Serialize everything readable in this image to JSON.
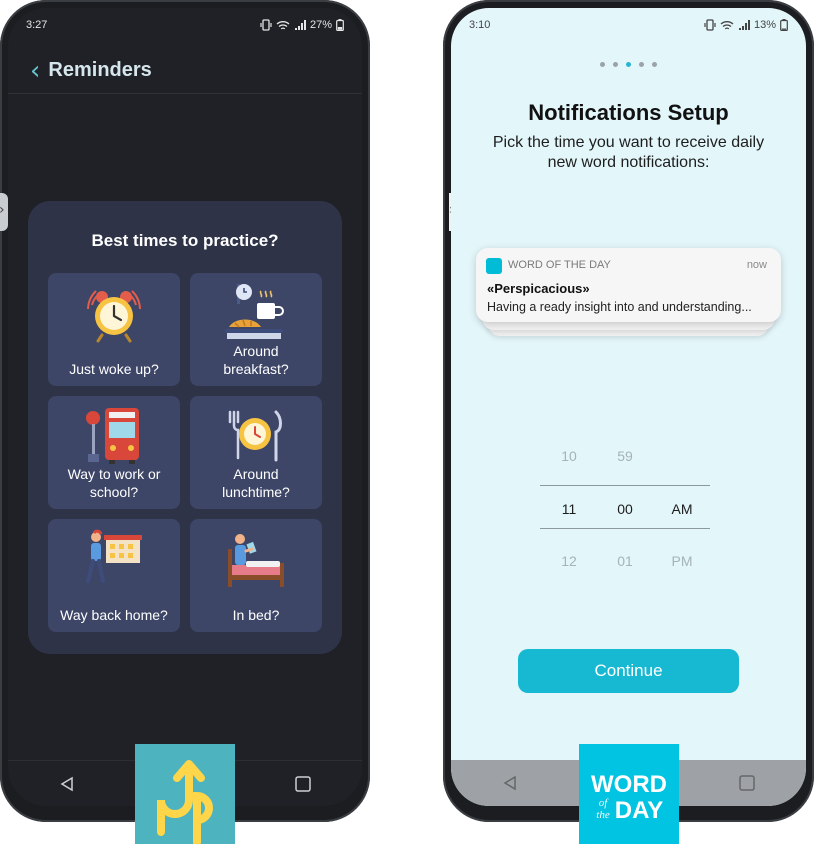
{
  "left_phone": {
    "status": {
      "time": "3:27",
      "battery": "27%"
    },
    "header": {
      "title": "Reminders"
    },
    "card": {
      "title": "Best times to practice?",
      "options": [
        {
          "label": "Just woke up?",
          "icon": "alarm-clock-icon"
        },
        {
          "label": "Around\nbreakfast?",
          "icon": "breakfast-icon"
        },
        {
          "label": "Way to work or\nschool?",
          "icon": "bus-stop-icon"
        },
        {
          "label": "Around\nlunchtime?",
          "icon": "lunch-plate-icon"
        },
        {
          "label": "Way back home?",
          "icon": "walking-home-icon"
        },
        {
          "label": "In bed?",
          "icon": "bed-reading-icon"
        }
      ]
    },
    "navigation": [
      "back-icon",
      "home-icon",
      "recents-icon"
    ]
  },
  "right_phone": {
    "status": {
      "time": "3:10",
      "battery": "13%"
    },
    "pager": {
      "count": 5,
      "active_index": 2
    },
    "title": "Notifications Setup",
    "subtitle": "Pick the time you want to receive daily new word notifications:",
    "notification": {
      "app_name": "WORD OF THE DAY",
      "time": "now",
      "title": "«Perspicacious»",
      "body": "Having a ready insight into and understanding..."
    },
    "time_picker": {
      "hours": [
        "10",
        "11",
        "12"
      ],
      "minutes": [
        "59",
        "00",
        "01"
      ],
      "periods": [
        "",
        "AM",
        "PM"
      ],
      "selected": {
        "hour": "11",
        "minute": "00",
        "period": "AM"
      }
    },
    "continue_label": "Continue",
    "navigation": [
      "back-icon",
      "home-icon",
      "recents-icon"
    ]
  },
  "logos": {
    "up": {
      "text": "Up",
      "color": "#4db3bf",
      "accent": "#ffd54a"
    },
    "word_of_the_day": {
      "line1": "WORD",
      "small1": "of",
      "small2": "the",
      "line2": "DAY",
      "color": "#00c4e1"
    }
  },
  "colors": {
    "reminders_accent": "#65c4cf",
    "tile_bg": "#3e4668",
    "card_bg": "#2e3347",
    "wotd_accent": "#17b8d1",
    "wotd_background": "#e3f6fa"
  }
}
